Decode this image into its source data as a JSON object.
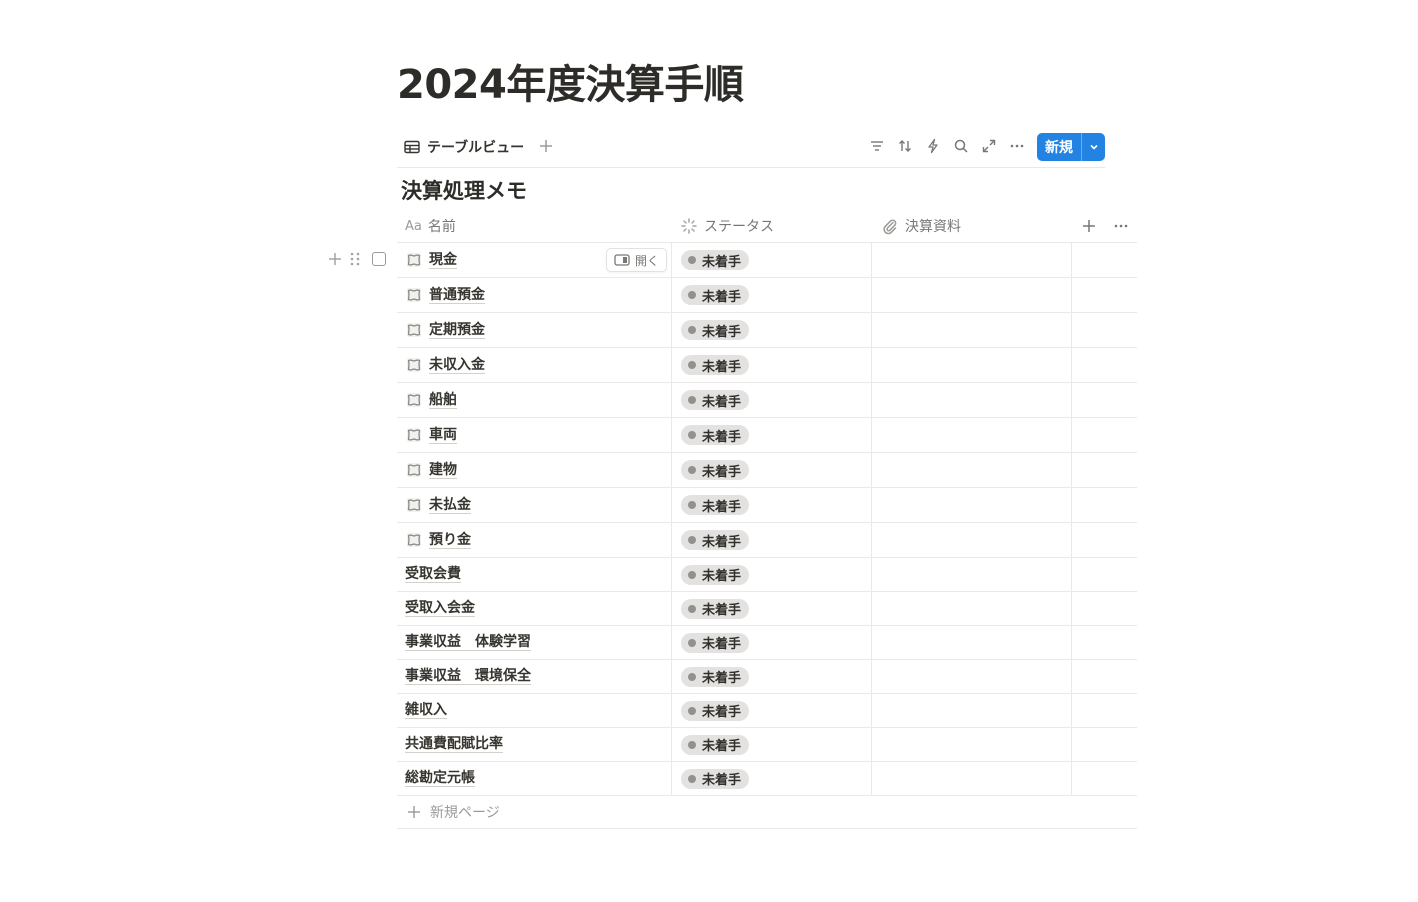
{
  "page": {
    "title": "2024年度決算手順"
  },
  "view_bar": {
    "tab_label": "テーブルビュー",
    "tab_icon": "table-icon",
    "add_view_icon": "plus-icon",
    "tools": [
      "filter-icon",
      "sort-icon",
      "lightning-icon",
      "search-icon",
      "expand-icon",
      "more-icon"
    ],
    "new_button_label": "新規",
    "accent_color": "#2383e2"
  },
  "database": {
    "title": "決算処理メモ",
    "columns": [
      {
        "key": "name",
        "label": "名前",
        "icon": "Aa"
      },
      {
        "key": "status",
        "label": "ステータス",
        "icon": "status-spinner-icon"
      },
      {
        "key": "files",
        "label": "決算資料",
        "icon": "paperclip-icon"
      }
    ],
    "add_column_icon": "plus-icon",
    "more_icon": "more-icon",
    "open_label": "開く",
    "rows": [
      {
        "name": "現金",
        "status": "未着手",
        "has_icon": true
      },
      {
        "name": "普通預金",
        "status": "未着手",
        "has_icon": true
      },
      {
        "name": "定期預金",
        "status": "未着手",
        "has_icon": true
      },
      {
        "name": "未収入金",
        "status": "未着手",
        "has_icon": true
      },
      {
        "name": "船舶",
        "status": "未着手",
        "has_icon": true
      },
      {
        "name": "車両",
        "status": "未着手",
        "has_icon": true
      },
      {
        "name": "建物",
        "status": "未着手",
        "has_icon": true
      },
      {
        "name": "未払金",
        "status": "未着手",
        "has_icon": true
      },
      {
        "name": "預り金",
        "status": "未着手",
        "has_icon": true
      },
      {
        "name": "受取会費",
        "status": "未着手",
        "has_icon": false
      },
      {
        "name": "受取入会金",
        "status": "未着手",
        "has_icon": false
      },
      {
        "name": "事業収益　体験学習",
        "status": "未着手",
        "has_icon": false
      },
      {
        "name": "事業収益　環境保全",
        "status": "未着手",
        "has_icon": false
      },
      {
        "name": "雑収入",
        "status": "未着手",
        "has_icon": false
      },
      {
        "name": "共通費配賦比率",
        "status": "未着手",
        "has_icon": false
      },
      {
        "name": "総勘定元帳",
        "status": "未着手",
        "has_icon": false
      }
    ],
    "new_page_label": "新規ページ"
  }
}
